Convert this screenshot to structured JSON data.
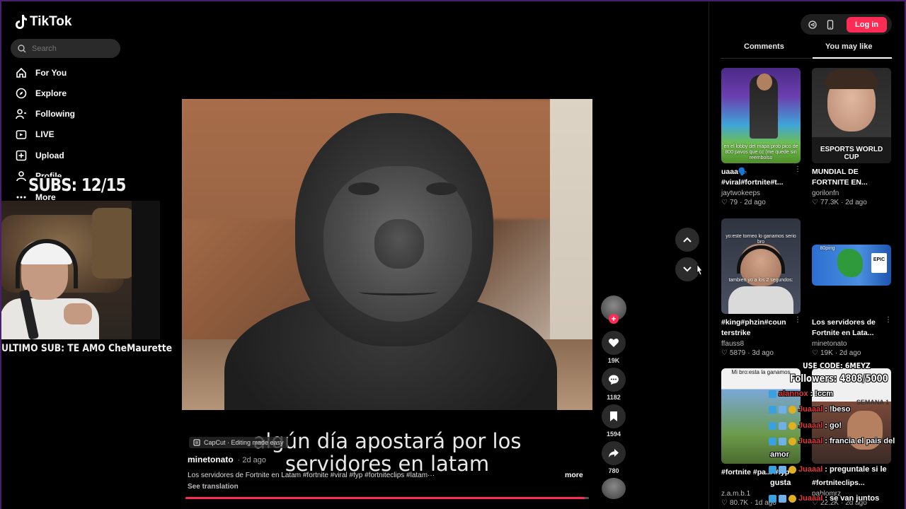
{
  "app": {
    "name": "TikTok",
    "accent_color": "#fe2c55"
  },
  "search": {
    "placeholder": "Search"
  },
  "sidebar": {
    "items": [
      {
        "label": "For You",
        "icon": "home-icon"
      },
      {
        "label": "Explore",
        "icon": "compass-icon"
      },
      {
        "label": "Following",
        "icon": "following-icon"
      },
      {
        "label": "LIVE",
        "icon": "live-icon"
      },
      {
        "label": "Upload",
        "icon": "upload-icon"
      },
      {
        "label": "Profile",
        "icon": "profile-icon"
      },
      {
        "label": "More",
        "icon": "more-icon"
      }
    ]
  },
  "stream_overlay": {
    "subs": "SUBS: 12/15",
    "last_sub": "ULTIMO SUB: TE AMO CheMaurette",
    "use_code": "USE CODE: 6MEYZ",
    "followers": "Followers: 4808/5000",
    "chat": [
      {
        "user": "alannox",
        "message": ": !ccm"
      },
      {
        "user": "Juaaal",
        "message": ": !beso"
      },
      {
        "user": "Juaaal",
        "message": ": go!"
      },
      {
        "user": "Juaaal",
        "message": ": francia el pais del",
        "continuation": "amor"
      },
      {
        "user": "Juaaal",
        "message": ": preguntale si le",
        "continuation": "gusta"
      },
      {
        "user": "Juaaal",
        "message": ": se van juntos"
      }
    ]
  },
  "video": {
    "capcut_label": "CapCut · Editing made easy",
    "subtitle_line1": "algún día apostará por los",
    "subtitle_line2": "servidores en latam",
    "author": "minetonato",
    "date": "· 2d ago",
    "description": "Los servidores de Fortnite en Latam #fortnite #viral #fyp #fortniteclips #latam···",
    "more": "more",
    "see_translation": "See translation",
    "progress_percent": 99
  },
  "actions": {
    "likes": "19K",
    "comments": "1182",
    "saves": "1594",
    "shares": "780"
  },
  "right_panel": {
    "login_label": "Log in",
    "tabs": [
      "Comments",
      "You may like"
    ],
    "active_tab": "You may like",
    "cards": [
      {
        "title": "uaaa🗣️ #viral#fortnite#t...",
        "author": "jaytwokeeps",
        "likes": "79",
        "date": "· 2d ago",
        "thumb_text": "en el lobby del mapa prob pico de 800 pavos que cc (me quede sin reembolso"
      },
      {
        "title": "MUNDIAL DE FORTNITE EN...",
        "author": "gorilonfn",
        "likes": "77.3K",
        "date": "· 2d ago",
        "thumb_text": "ESPORTS WORLD CUP"
      },
      {
        "title": "#king#phzin#coun terstrike",
        "author": "ffauss8",
        "likes": "5879",
        "date": "· 3d ago",
        "thumb_text": "yo:este torneo lo ganamos serio bro",
        "thumb_text2": "tambien yo a los 2 segundos:"
      },
      {
        "title": "Los servidores de Fortnite en Lata...",
        "author": "minetonato",
        "likes": "19K",
        "date": "· 2d ago",
        "thumb_text": "80ping",
        "thumb_text2": "EPIC"
      },
      {
        "title": "#fortnite #pa... #fyp",
        "author": "z.a.m.b.1",
        "likes": "80.7K",
        "date": "· 1d ago",
        "thumb_text": "Mi bro:esta la ganamos"
      },
      {
        "title": "#fortniteclips...",
        "author": "pablomrz",
        "likes": "22.2K",
        "date": "· 2d ago",
        "thumb_text": "SEMANA 1"
      }
    ]
  }
}
